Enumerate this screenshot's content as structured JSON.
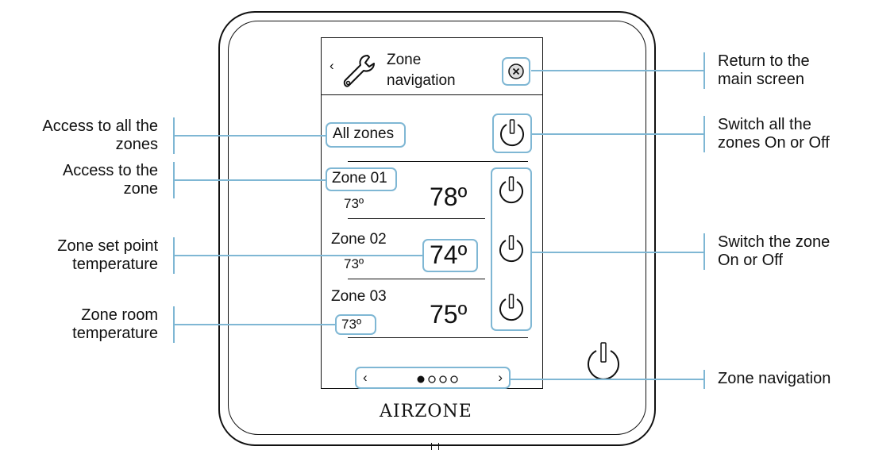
{
  "screen": {
    "title_line1": "Zone",
    "title_line2": "navigation",
    "all_zones_label": "All zones",
    "zones": [
      {
        "name": "Zone 01",
        "room_temp": "73º",
        "set_temp": "78º"
      },
      {
        "name": "Zone 02",
        "room_temp": "73º",
        "set_temp": "74º"
      },
      {
        "name": "Zone 03",
        "room_temp": "73º",
        "set_temp": "75º"
      }
    ],
    "pager": {
      "prev": "‹",
      "next": "›",
      "dots": "●○○○"
    }
  },
  "brand": "AIRZONE",
  "callouts": {
    "return_line1": "Return to the",
    "return_line2": "main screen",
    "switch_all_line1": "Switch all the",
    "switch_all_line2": "zones On or Off",
    "switch_zone_line1": "Switch the zone",
    "switch_zone_line2": "On or Off",
    "zone_navigation": "Zone navigation",
    "access_all_line1": "Access to all the",
    "access_all_line2": "zones",
    "access_zone_line1": "Access to the",
    "access_zone_line2": "zone",
    "set_point_line1": "Zone set point",
    "set_point_line2": "temperature",
    "room_temp_line1": "Zone room",
    "room_temp_line2": "temperature"
  },
  "colors": {
    "highlight": "#7fb7d4",
    "outline": "#111111"
  },
  "icons": [
    "wrench-icon",
    "close-icon",
    "power-icon",
    "chevron-left-icon",
    "chevron-right-icon"
  ]
}
